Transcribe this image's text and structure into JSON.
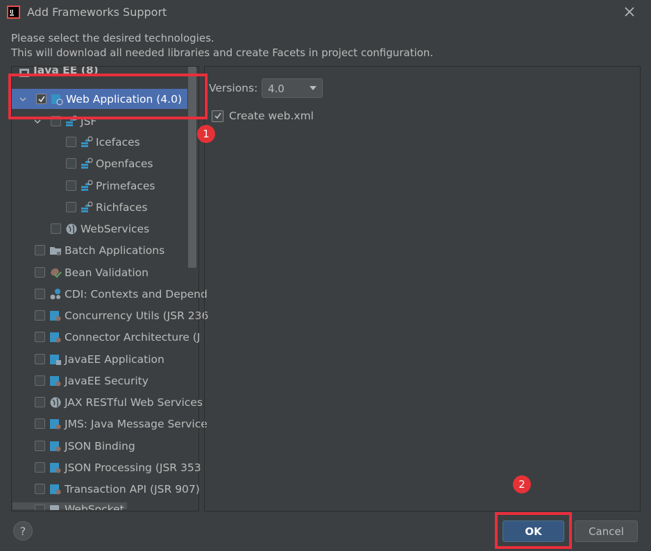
{
  "window": {
    "title": "Add Frameworks Support",
    "close_icon": "close-icon",
    "app_icon": "intellij-logo-icon"
  },
  "description": {
    "line1": "Please select the desired technologies.",
    "line2": "This will download all needed libraries and create Facets in project configuration."
  },
  "tree": {
    "group_partial": "Java EE (8)",
    "items": [
      {
        "label": "Web Application (4.0)",
        "checked": true,
        "selected": true,
        "expanded": true,
        "icon": "web-app-icon"
      },
      {
        "label": "JSF",
        "checked": false,
        "expanded": true,
        "icon": "jsf-icon"
      },
      {
        "label": "Icefaces",
        "checked": false,
        "icon": "jsf-icon"
      },
      {
        "label": "Openfaces",
        "checked": false,
        "icon": "jsf-icon"
      },
      {
        "label": "Primefaces",
        "checked": false,
        "icon": "jsf-icon"
      },
      {
        "label": "Richfaces",
        "checked": false,
        "icon": "jsf-icon"
      },
      {
        "label": "WebServices",
        "checked": false,
        "icon": "globe-icon"
      },
      {
        "label": "Batch Applications",
        "checked": false,
        "icon": "folder-icon"
      },
      {
        "label": "Bean Validation",
        "checked": false,
        "icon": "bean-validation-icon"
      },
      {
        "label": "CDI: Contexts and Depend",
        "checked": false,
        "icon": "cdi-icon"
      },
      {
        "label": "Concurrency Utils (JSR 236",
        "checked": false,
        "icon": "javaee-module-icon"
      },
      {
        "label": "Connector Architecture (J",
        "checked": false,
        "icon": "javaee-module-icon"
      },
      {
        "label": "JavaEE Application",
        "checked": false,
        "icon": "javaee-app-icon"
      },
      {
        "label": "JavaEE Security",
        "checked": false,
        "icon": "javaee-module-icon"
      },
      {
        "label": "JAX RESTful Web Services",
        "checked": false,
        "icon": "globe-icon"
      },
      {
        "label": "JMS: Java Message Service",
        "checked": false,
        "icon": "javaee-module-icon"
      },
      {
        "label": "JSON Binding",
        "checked": false,
        "icon": "javaee-module-icon"
      },
      {
        "label": "JSON Processing (JSR 353",
        "checked": false,
        "icon": "javaee-module-icon"
      },
      {
        "label": "Transaction API (JSR 907)",
        "checked": false,
        "icon": "javaee-module-icon"
      },
      {
        "label": "WebSocket",
        "checked": false,
        "icon": "websocket-icon"
      }
    ]
  },
  "options": {
    "versions_label": "Versions:",
    "versions_value": "4.0",
    "create_web_xml_label": "Create web.xml",
    "create_web_xml_checked": true
  },
  "annotations": {
    "badge1": "1",
    "badge2": "2"
  },
  "buttons": {
    "help_label": "?",
    "ok_label": "OK",
    "cancel_label": "Cancel"
  },
  "colors": {
    "background": "#3c3f41",
    "selection": "#4b6eaf",
    "ok_button": "#365880",
    "annotation_red": "#ea2e3c"
  }
}
